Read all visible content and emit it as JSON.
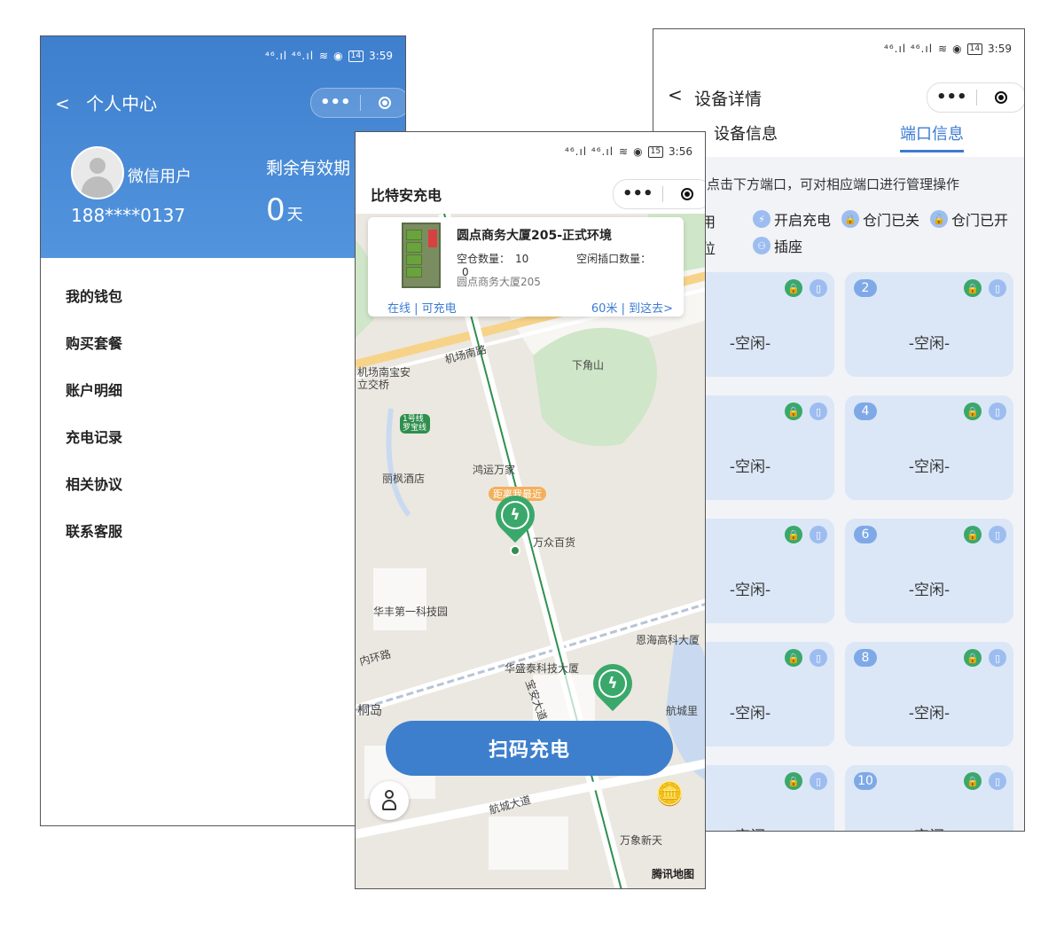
{
  "phone1": {
    "status": {
      "signal": "⁴⁶.ıl ⁴⁶.ıl",
      "battery": "14",
      "time": "3:59"
    },
    "nav_title": "个人中心",
    "user": {
      "name": "微信用户",
      "phone": "188****0137"
    },
    "validity": {
      "label": "剩余有效期",
      "value": "0",
      "unit": "天"
    },
    "menu": [
      "我的钱包",
      "购买套餐",
      "账户明细",
      "充电记录",
      "相关协议",
      "联系客服"
    ]
  },
  "phone2": {
    "status": {
      "signal": "⁴⁶.ıl ⁴⁶.ıl",
      "battery": "15",
      "time": "3:56"
    },
    "title": "比特安充电",
    "station": {
      "name": "圆点商务大厦205-正式环境",
      "empty_bins_label": "空仓数量：",
      "empty_bins": "10",
      "idle_ports_label": "空闲插口数量：",
      "idle_ports": "0",
      "address": "圆点商务大厦205",
      "status": "在线 | 可充电",
      "distance": "60米 | 到这去>"
    },
    "map_labels": [
      "机场南路",
      "下角山",
      "机场南宝安立交桥",
      "1号线罗宝线",
      "丽枫酒店",
      "鸿运万家",
      "距离我最近",
      "万众百货",
      "华丰第一科技园",
      "恩海高科大厦",
      "内环路",
      "华盛泰科技大厦",
      "桐岛",
      "宝安大道",
      "航城里",
      "航城大道",
      "万象新天",
      "腾讯地图"
    ],
    "scan_button": "扫码充电",
    "colors": {
      "primary": "#3d7fcc",
      "pin": "#3aa86a"
    }
  },
  "phone3": {
    "status": {
      "signal": "⁴⁶.ıl ⁴⁶.ıl",
      "battery": "14",
      "time": "3:59"
    },
    "title": "设备详情",
    "tabs": [
      "设备信息",
      "端口信息"
    ],
    "hint": "点击下方端口，可对相应端口进行管理操作",
    "legend": [
      {
        "icon": "lightning-icon",
        "label": "开启充电"
      },
      {
        "icon": "lock-closed-icon",
        "label": "仓门已关"
      },
      {
        "icon": "lock-open-icon",
        "label": "仓门已开"
      },
      {
        "icon": "socket-icon",
        "label": "插座"
      }
    ],
    "legend_partial": [
      "用",
      "位"
    ],
    "ports": [
      {
        "num": "",
        "state": "-空闲-"
      },
      {
        "num": "2",
        "state": "-空闲-"
      },
      {
        "num": "",
        "state": "-空闲-"
      },
      {
        "num": "4",
        "state": "-空闲-"
      },
      {
        "num": "",
        "state": "-空闲-"
      },
      {
        "num": "6",
        "state": "-空闲-"
      },
      {
        "num": "",
        "state": "-空闲-"
      },
      {
        "num": "8",
        "state": "-空闲-"
      },
      {
        "num": "",
        "state": "-空闲-"
      },
      {
        "num": "10",
        "state": "-空闲-"
      }
    ],
    "colors": {
      "accent": "#3b7bd4",
      "port_bg": "#dbe7f7",
      "lock": "#3aa86a"
    }
  }
}
